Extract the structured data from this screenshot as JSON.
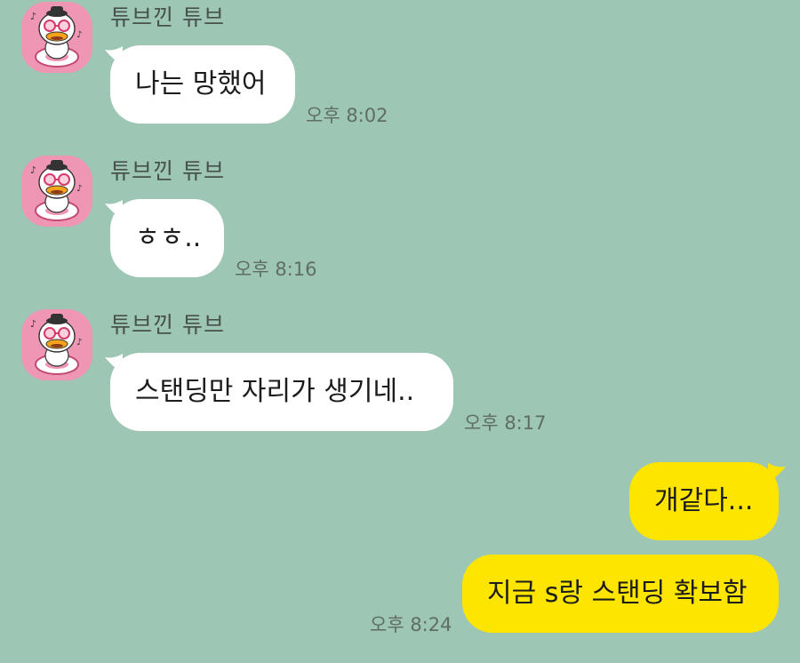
{
  "chat": {
    "colors": {
      "background": "#9dc6b4",
      "incoming_bubble": "#ffffff",
      "outgoing_bubble": "#fee500",
      "avatar_bg": "#ee96b3"
    },
    "incoming": [
      {
        "sender": "튜브낀 튜브",
        "text": "나는 망했어",
        "time": "오후 8:02",
        "avatar_icon": "tube-duck-icon"
      },
      {
        "sender": "튜브낀 튜브",
        "text": "ㅎㅎ..",
        "time": "오후 8:16",
        "avatar_icon": "tube-duck-icon"
      },
      {
        "sender": "튜브낀 튜브",
        "text": "스탠딩만 자리가 생기네..",
        "time": "오후 8:17",
        "avatar_icon": "tube-duck-icon"
      }
    ],
    "outgoing": [
      {
        "text": "개같다..."
      },
      {
        "text": "지금 s랑 스탠딩 확보함",
        "time": "오후 8:24"
      }
    ]
  }
}
